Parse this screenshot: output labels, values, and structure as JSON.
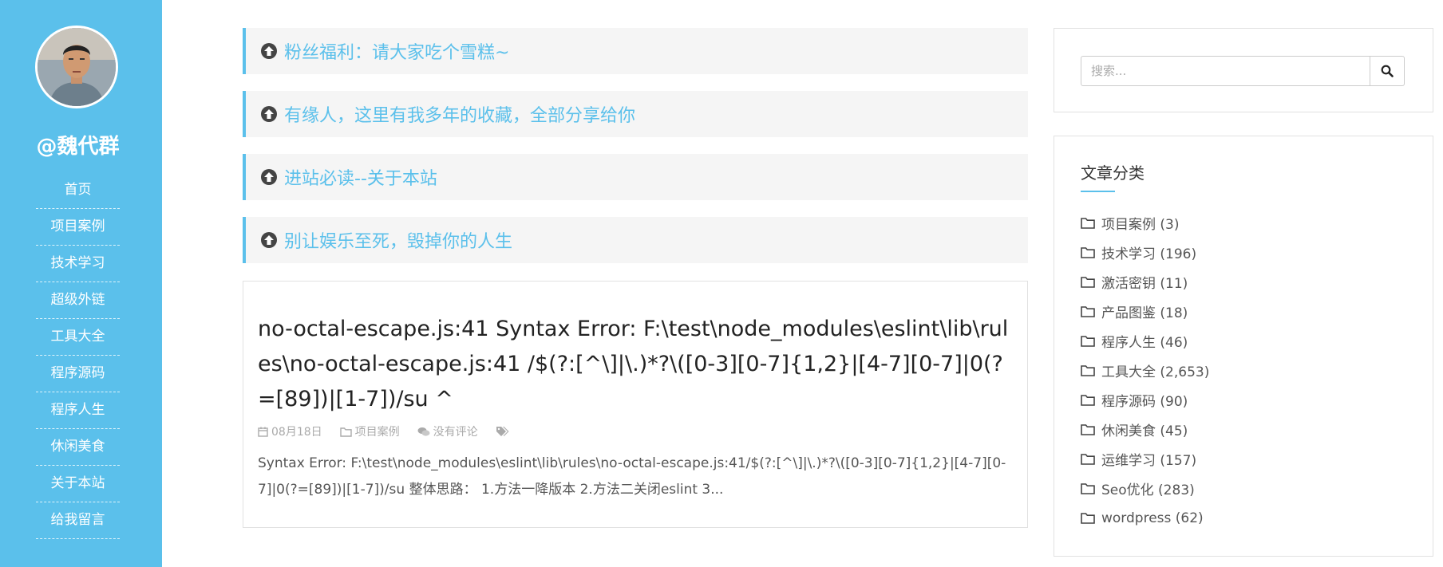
{
  "sidebar": {
    "site_name": "@魏代群",
    "nav": [
      "首页",
      "项目案例",
      "技术学习",
      "超级外链",
      "工具大全",
      "程序源码",
      "程序人生",
      "休闲美食",
      "关于本站",
      "给我留言"
    ]
  },
  "notices": [
    "粉丝福利：请大家吃个雪糕~",
    "有缘人，这里有我多年的收藏，全部分享给你",
    "进站必读--关于本站",
    "别让娱乐至死，毁掉你的人生"
  ],
  "post": {
    "title": "no-octal-escape.js:41 Syntax Error: F:\\test\\node_modules\\eslint\\lib\\rules\\no-octal-escape.js:41 /$(?:[^\\]|\\.)*?\\([0-3][0-7]{1,2}|[4-7][0-7]|0(?=[89])|[1-7])/su ^",
    "date": "08月18日",
    "category": "项目案例",
    "comments": "没有评论",
    "excerpt": "Syntax Error: F:\\test\\node_modules\\eslint\\lib\\rules\\no-octal-escape.js:41/$(?:[^\\]|\\.)*?\\([0-3][0-7]{1,2}|[4-7][0-7]|0(?=[89])|[1-7])/su 整体思路： 1.方法一降版本 2.方法二关闭eslint 3..."
  },
  "search": {
    "placeholder": "搜索..."
  },
  "categories": {
    "title": "文章分类",
    "items": [
      "项目案例 (3)",
      "技术学习 (196)",
      "激活密钥 (11)",
      "产品图鉴 (18)",
      "程序人生 (46)",
      "工具大全 (2,653)",
      "程序源码 (90)",
      "休闲美食 (45)",
      "运维学习 (157)",
      "Seo优化 (283)",
      "wordpress (62)"
    ]
  },
  "colors": {
    "accent": "#5bc0eb",
    "notice_bg": "#f5f5f5"
  }
}
